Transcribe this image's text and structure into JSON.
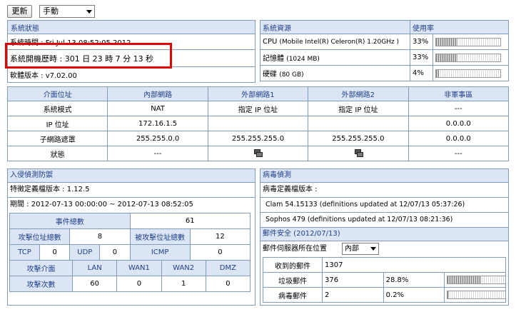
{
  "toolbar": {
    "refresh_label": "更新",
    "mode_value": "手動"
  },
  "system_status": {
    "title": "系統狀態",
    "system_time": "系統時間 : Fri Jul 13 08:52:05 2012",
    "uptime": "系統開機歷時 : 301 日 23 時 7 分 13 秒",
    "firmware": "軟體版本 : v7.02.00"
  },
  "resources": {
    "title": "系統資源",
    "usage_title": "使用率",
    "rows": [
      {
        "label": "CPU",
        "detail": "(Mobile Intel(R) Celeron(R) 1.20GHz )",
        "percent": "33%",
        "value": 0.33
      },
      {
        "label": "記憶體",
        "detail": "(1024 MB)",
        "percent": "33%",
        "value": 0.33
      },
      {
        "label": "硬碟",
        "detail": "(80 GB)",
        "percent": "4%",
        "value": 0.04
      }
    ]
  },
  "interfaces": {
    "headers": [
      "介面位址",
      "內部網路",
      "外部網路1",
      "外部網路2",
      "非軍事區"
    ],
    "rows": [
      {
        "label": "系統模式",
        "cells": [
          "NAT",
          "指定 IP 位址",
          "指定 IP 位址",
          "---"
        ]
      },
      {
        "label": "IP 位址",
        "cells": [
          "172.16.1.5",
          "",
          "",
          "0.0.0.0"
        ]
      },
      {
        "label": "子網路遮罩",
        "cells": [
          "255.255.0.0",
          "255.255.255.0",
          "255.255.255.0",
          "0.0.0.0"
        ]
      },
      {
        "label": "狀態",
        "cells": [
          "---",
          "",
          "",
          "---"
        ]
      }
    ]
  },
  "ids": {
    "title": "入侵偵測防禦",
    "signature_version": "特徵定義檔版本 : 1.12.5",
    "period": "期間 : 2012-07-13 00:00:00 ~ 2012-07-13 08:52:05",
    "total_events_label": "事件總數",
    "total_events": "61",
    "attack_src_label": "攻擊位址總數",
    "attack_src": "8",
    "attacked_label": "被攻擊位址總數",
    "attacked": "12",
    "tcp_label": "TCP",
    "tcp": "0",
    "udp_label": "UDP",
    "udp": "0",
    "icmp_label": "ICMP",
    "icmp": "0",
    "iface_label": "攻擊介面",
    "ifaces": [
      "LAN",
      "WAN1",
      "WAN2",
      "DMZ"
    ],
    "count_label": "攻擊次數",
    "counts": [
      "60",
      "0",
      "1",
      "0"
    ]
  },
  "virus": {
    "title": "病毒偵測",
    "version_label": "病毒定義檔版本 :",
    "clam": "Clam 54.15133 (definitions updated at 12/07/13 05:37:26)",
    "sophos": "Sophos 479 (definitions updated at 12/07/13 08:21:36)"
  },
  "mail": {
    "title": "郵件安全 (2012/07/13)",
    "server_label": "郵件伺服器所在位置",
    "server_value": "內部",
    "received_label": "收到的郵件",
    "received": "1307",
    "spam_label": "垃圾郵件",
    "spam": "376",
    "spam_pct": "28.8%",
    "spam_value": 0.288,
    "virus_label": "病毒郵件",
    "virus": "2",
    "virus_pct": "0.2%",
    "virus_value": 0.002
  }
}
